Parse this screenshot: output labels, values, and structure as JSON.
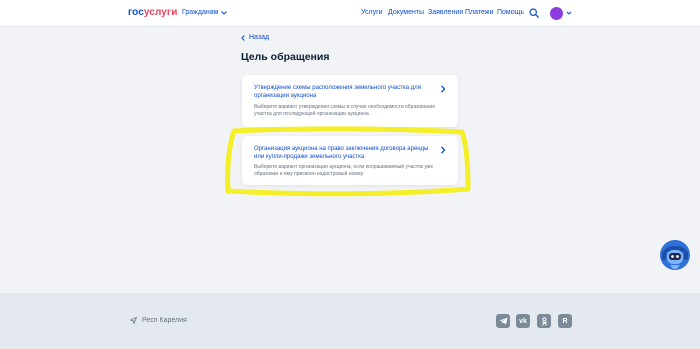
{
  "header": {
    "logo_part1": "гос",
    "logo_part2": "услуги",
    "audience": "Гражданам",
    "nav": [
      "Услуги",
      "Документы",
      "Заявления",
      "Платежи",
      "Помощь"
    ],
    "avatar_color": "#8f3adf"
  },
  "main": {
    "back_label": "Назад",
    "title": "Цель обращения",
    "options": [
      {
        "title": "Утверждение схемы расположения земельного участка для организации аукциона",
        "description": "Выберите вариант утверждения схемы в случае необходимости образования участка для последующей организации аукциона"
      },
      {
        "title": "Организация аукциона на право заключения договора аренды или купли-продажи земельного участка",
        "description": "Выберите вариант организации аукциона, если испрашиваемый участок уже образован и ему присвоен кадастровый номер"
      }
    ]
  },
  "footer": {
    "region": "Респ Карелия",
    "social": [
      "telegram-icon",
      "vk-icon",
      "odnoklassniki-icon",
      "rutube-icon"
    ]
  },
  "colors": {
    "accent": "#0d4cd3",
    "brand_red": "#ee3f58",
    "highlight": "#f4ee1e"
  }
}
